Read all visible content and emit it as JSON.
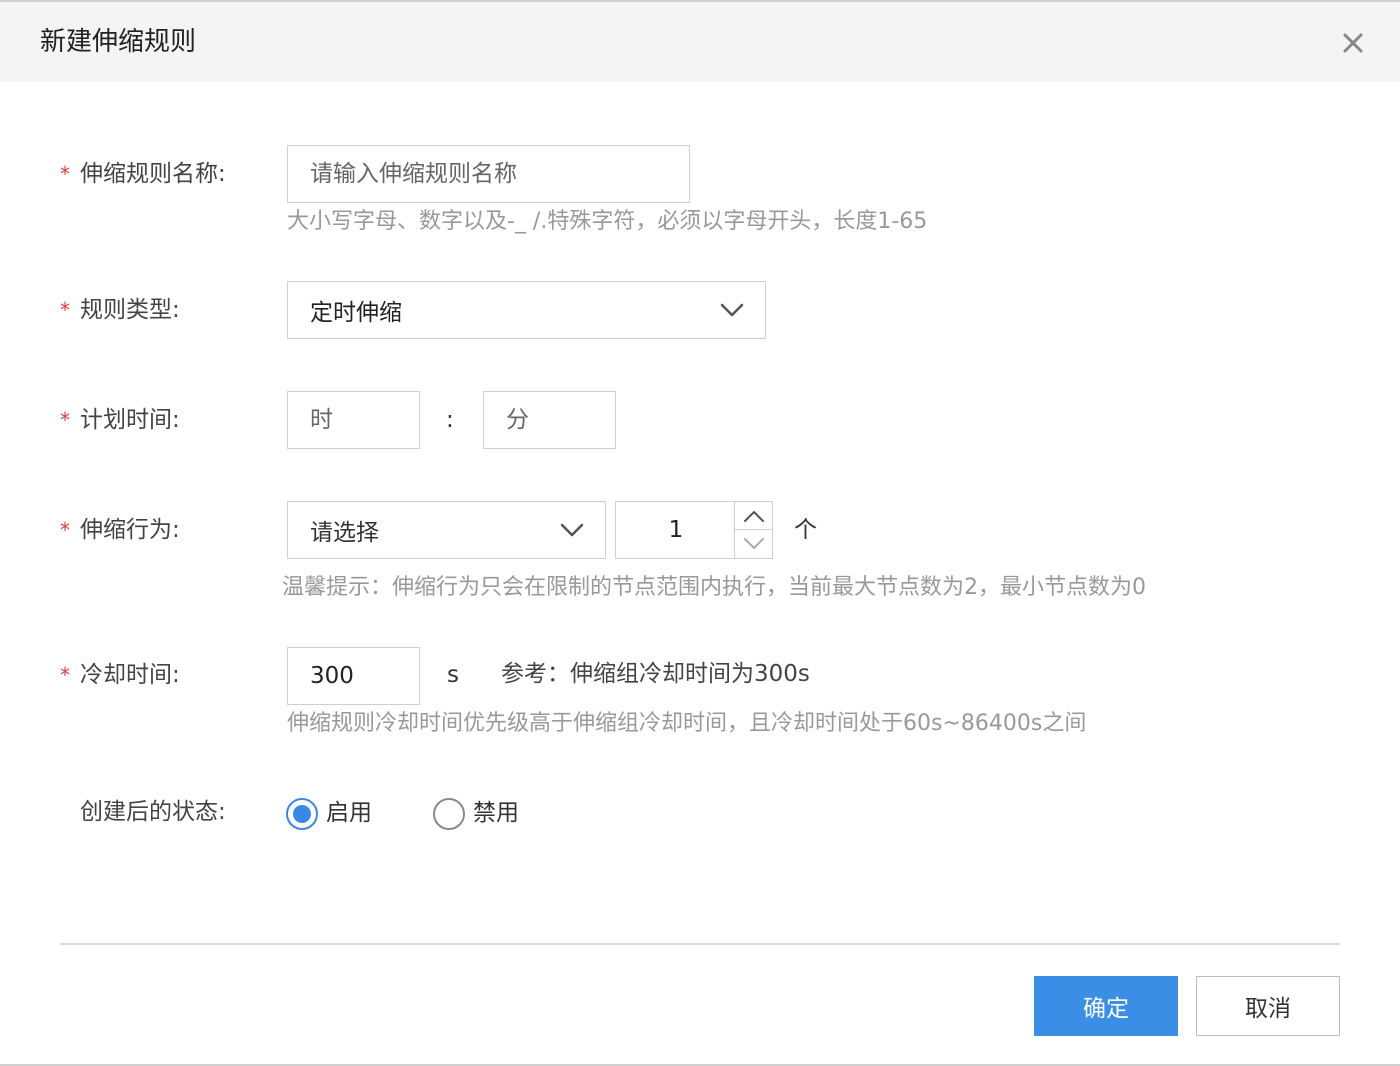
{
  "dialog": {
    "title": "新建伸缩规则"
  },
  "form": {
    "rule_name": {
      "required_mark": "*",
      "label": "伸缩规则名称:",
      "value": "",
      "placeholder": "请输入伸缩规则名称",
      "hint": "大小写字母、数字以及-_ /.特殊字符，必须以字母开头，长度1-65"
    },
    "rule_type": {
      "required_mark": "*",
      "label": "规则类型:",
      "selected": "定时伸缩"
    },
    "plan_time": {
      "required_mark": "*",
      "label": "计划时间:",
      "hour_placeholder": "时",
      "separator": ":",
      "minute_placeholder": "分"
    },
    "scale_action": {
      "required_mark": "*",
      "label": "伸缩行为:",
      "action_placeholder": "请选择",
      "count_value": "1",
      "unit": "个",
      "hint": "温馨提示：伸缩行为只会在限制的节点范围内执行，当前最大节点数为2，最小节点数为0"
    },
    "cooldown": {
      "required_mark": "*",
      "label": "冷却时间:",
      "value": "300",
      "unit": "s",
      "reference": "参考：伸缩组冷却时间为300s",
      "hint": "伸缩规则冷却时间优先级高于伸缩组冷却时间，且冷却时间处于60s~86400s之间"
    },
    "status": {
      "label": "创建后的状态:",
      "options": [
        {
          "label": "启用",
          "checked": true
        },
        {
          "label": "禁用",
          "checked": false
        }
      ]
    }
  },
  "footer": {
    "confirm_label": "确定",
    "cancel_label": "取消"
  },
  "colors": {
    "primary": "#3a8ee6",
    "required": "#e5393a",
    "header_bg": "#f4f4f4"
  },
  "icons": {
    "close": "close-icon",
    "select_arrow": "chevron-down-icon",
    "step_up": "chevron-up-icon",
    "step_down": "chevron-down-icon"
  }
}
